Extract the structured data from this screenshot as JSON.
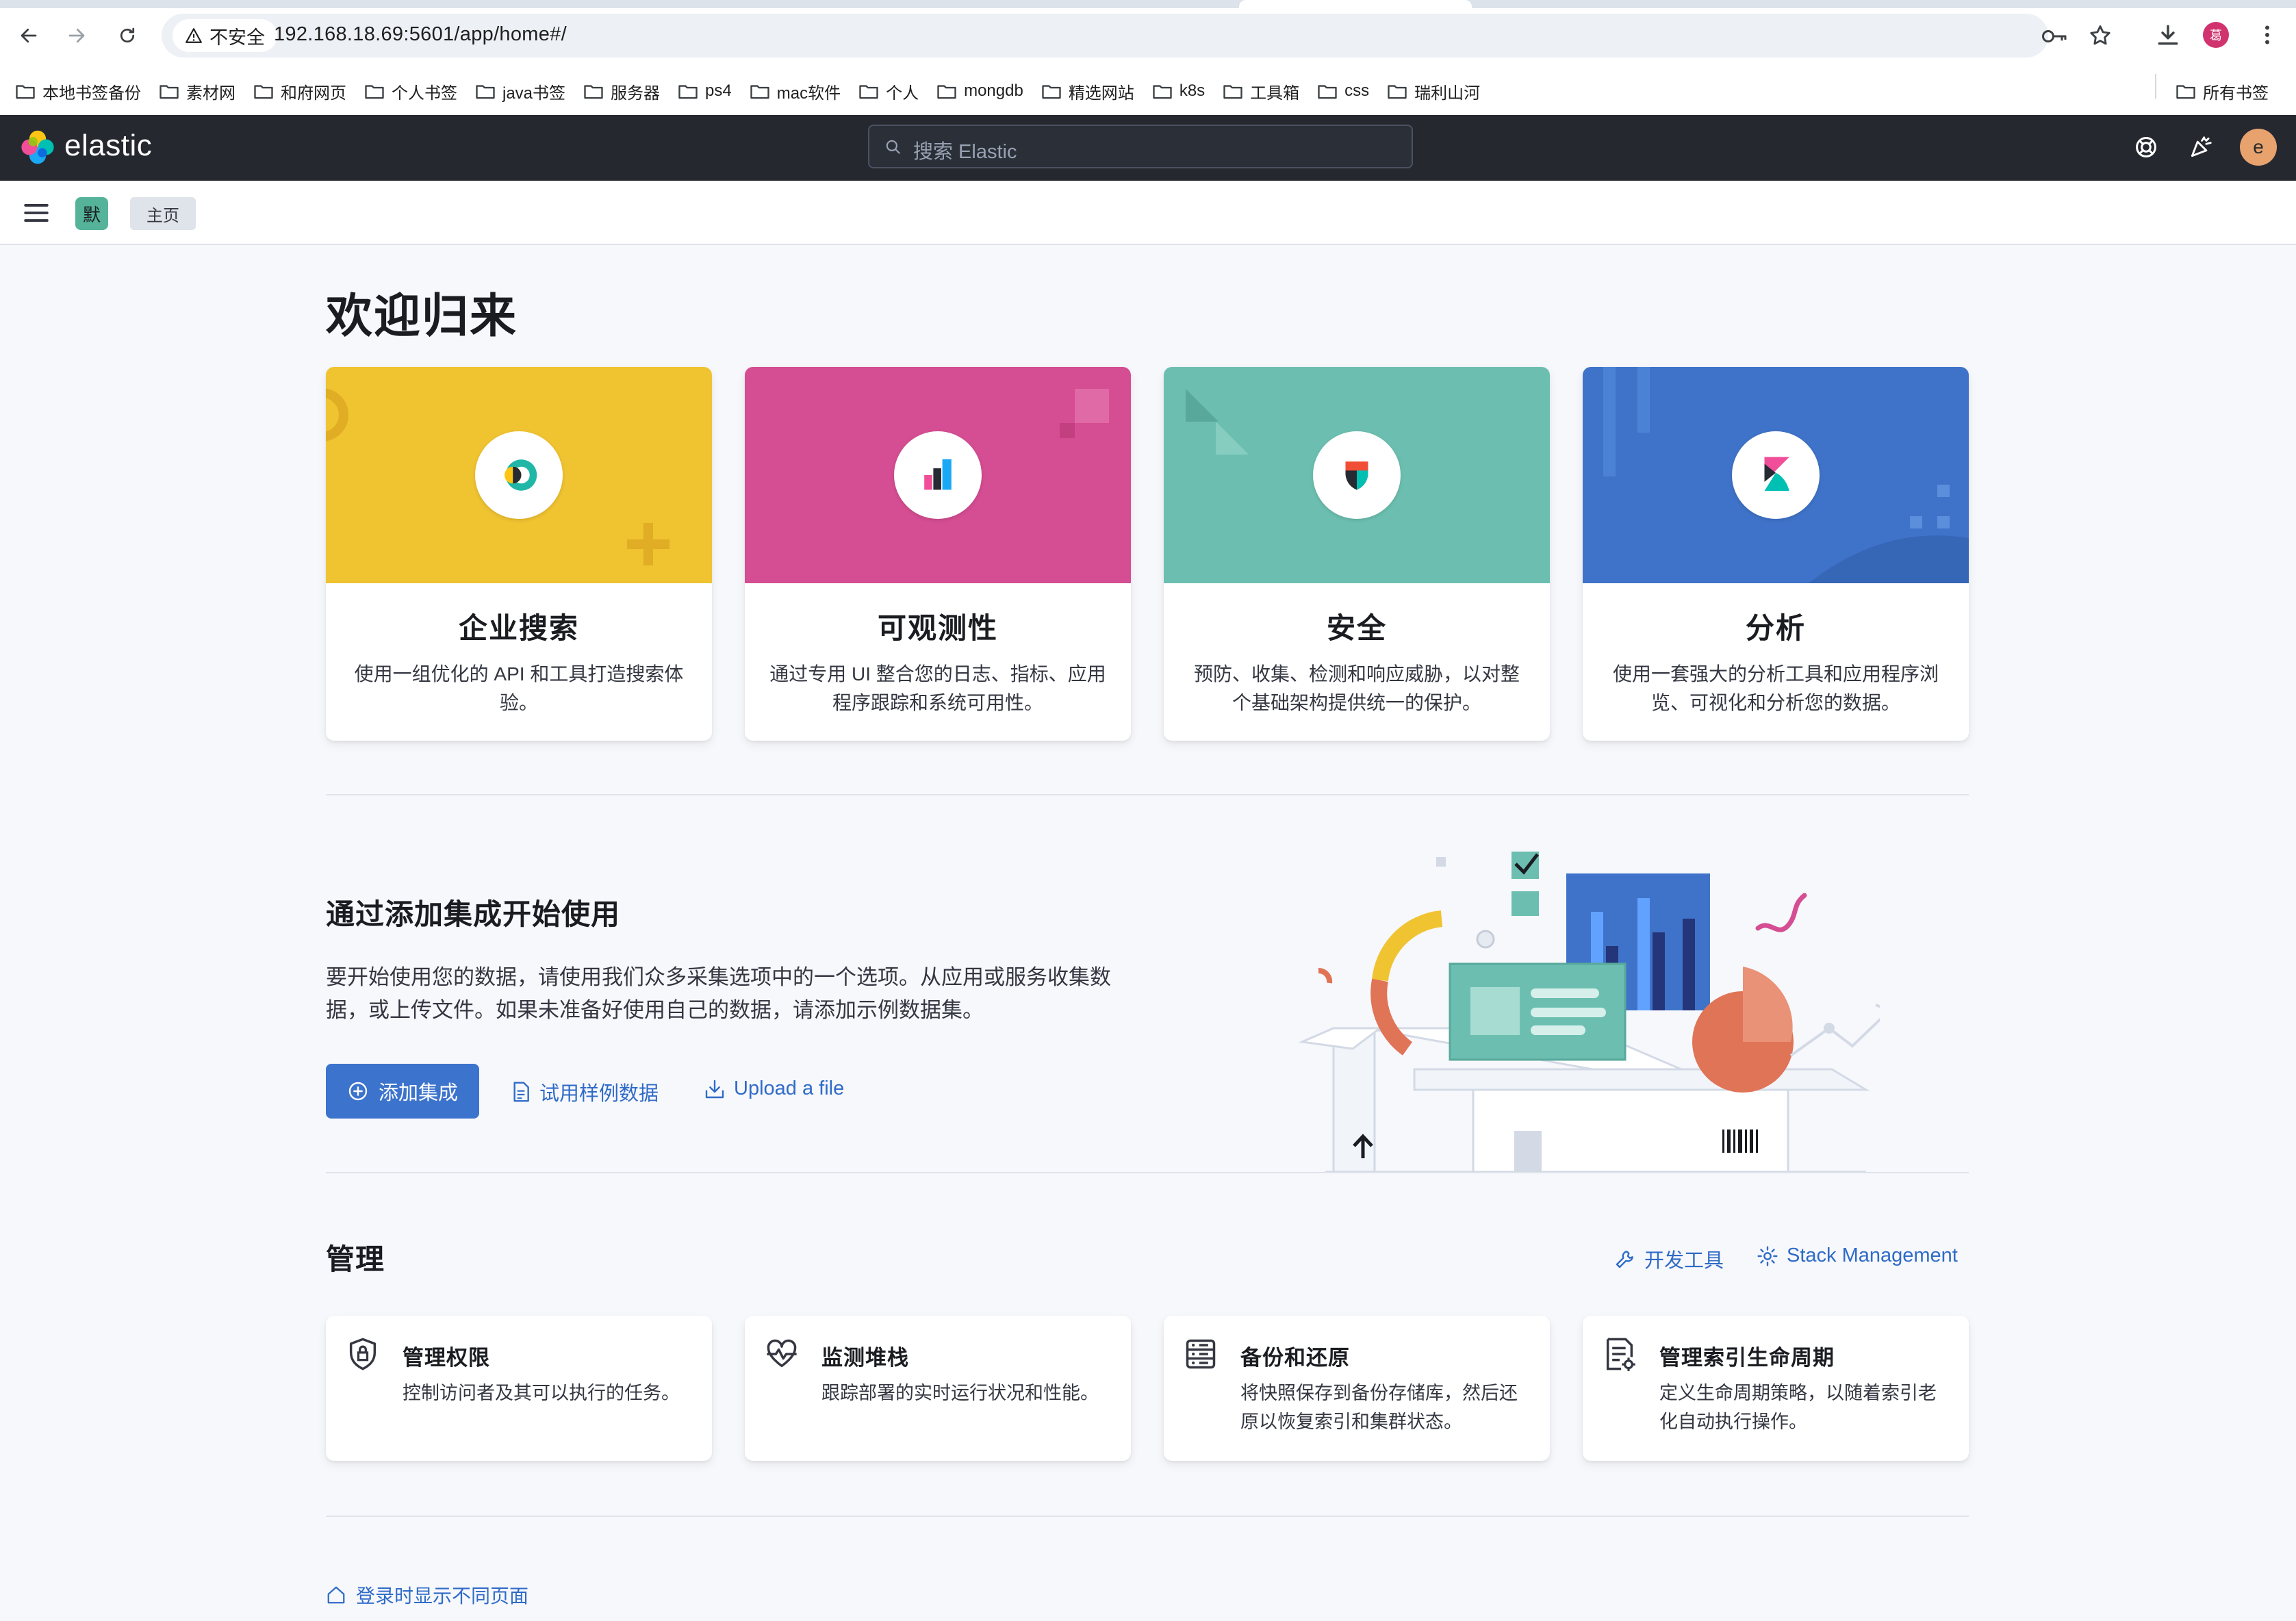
{
  "browser": {
    "security_label": "不安全",
    "url": "192.168.18.69:5601/app/home#/",
    "bookmarks": [
      "本地书签备份",
      "素材网",
      "和府网页",
      "个人书签",
      "java书签",
      "服务器",
      "ps4",
      "mac软件",
      "个人",
      "mongdb",
      "精选网站",
      "k8s",
      "工具箱",
      "css",
      "瑞利山河"
    ],
    "all_bookmarks": "所有书签",
    "profile_letter": "葛"
  },
  "header": {
    "brand": "elastic",
    "search_placeholder": "搜索 Elastic",
    "user_initial": "e"
  },
  "breadcrumb": {
    "space_letter": "默",
    "current": "主页"
  },
  "page": {
    "title": "欢迎归来"
  },
  "solutions": [
    {
      "title": "企业搜索",
      "desc": "使用一组优化的 API 和工具打造搜索体验。",
      "color": "#f0c331"
    },
    {
      "title": "可观测性",
      "desc": "通过专用 UI 整合您的日志、指标、应用程序跟踪和系统可用性。",
      "color": "#d54d92"
    },
    {
      "title": "安全",
      "desc": "预防、收集、检测和响应威胁，以对整个基础架构提供统一的保护。",
      "color": "#6cbfb0"
    },
    {
      "title": "分析",
      "desc": "使用一套强大的分析工具和应用程序浏览、可视化和分析您的数据。",
      "color": "#3f73c9"
    }
  ],
  "integrations": {
    "title": "通过添加集成开始使用",
    "desc": "要开始使用您的数据，请使用我们众多采集选项中的一个选项。从应用或服务收集数据，或上传文件。如果未准备好使用自己的数据，请添加示例数据集。",
    "add_button": "添加集成",
    "sample_button": "试用样例数据",
    "upload_button": "Upload a file"
  },
  "management": {
    "title": "管理",
    "dev_tools": "开发工具",
    "stack_management": "Stack Management",
    "cards": [
      {
        "title": "管理权限",
        "desc": "控制访问者及其可以执行的任务。",
        "icon": "shield-lock-icon"
      },
      {
        "title": "监测堆栈",
        "desc": "跟踪部署的实时运行状况和性能。",
        "icon": "heartbeat-icon"
      },
      {
        "title": "备份和还原",
        "desc": "将快照保存到备份存储库，然后还原以恢复索引和集群状态。",
        "icon": "storage-icon"
      },
      {
        "title": "管理索引生命周期",
        "desc": "定义生命周期策略，以随着索引老化自动执行操作。",
        "icon": "index-settings-icon"
      }
    ]
  },
  "footer": {
    "login_link": "登录时显示不同页面"
  }
}
